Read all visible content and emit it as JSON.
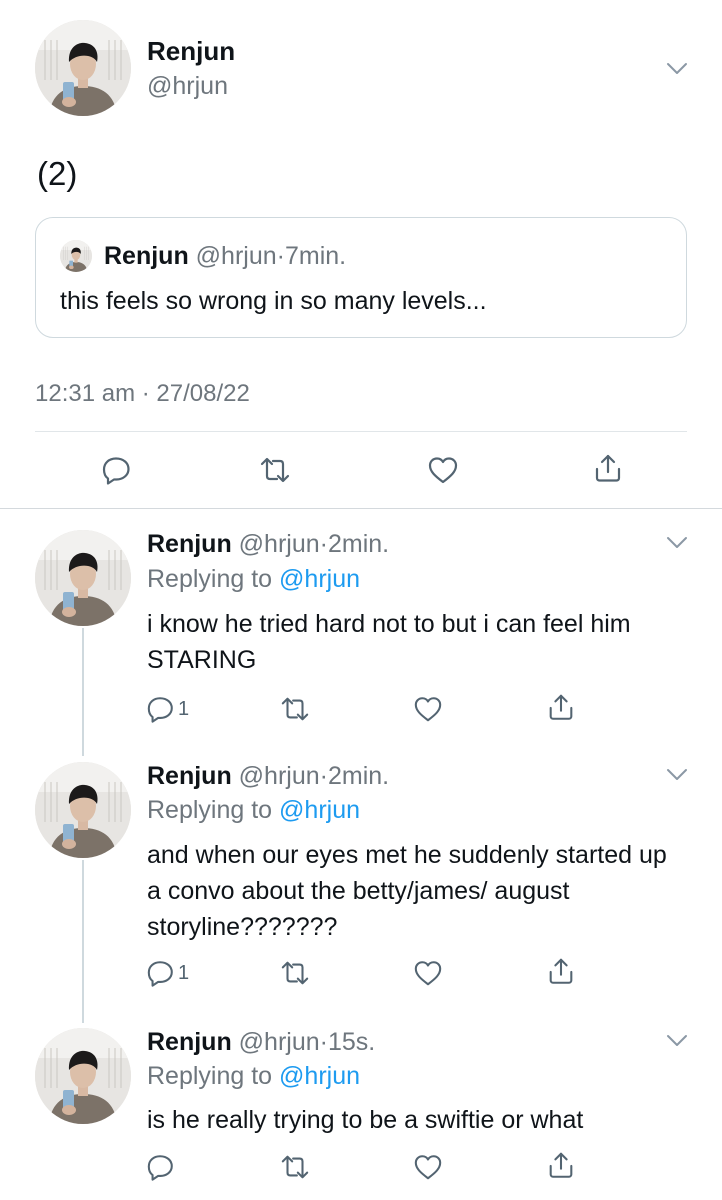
{
  "colors": {
    "text": "#0f1419",
    "secondary": "#6e767d",
    "accent": "#1d9bf0",
    "border": "#cfd9de"
  },
  "main_tweet": {
    "display_name": "Renjun",
    "handle": "@hrjun",
    "text": "(2)",
    "quote": {
      "display_name": "Renjun",
      "handle": "@hrjun",
      "time": "7min.",
      "text": "this feels so wrong in so many levels..."
    },
    "timestamp": "12:31 am · 27/08/22",
    "icons": [
      "reply-icon",
      "retweet-icon",
      "like-icon",
      "share-icon"
    ]
  },
  "replies": [
    {
      "display_name": "Renjun",
      "handle": "@hrjun",
      "time": "2min.",
      "replying_label": "Replying to",
      "replying_to": "@hrjun",
      "text": "i know he tried hard not to but i can feel him STARING",
      "reply_count": "1"
    },
    {
      "display_name": "Renjun",
      "handle": "@hrjun",
      "time": "2min.",
      "replying_label": "Replying to",
      "replying_to": "@hrjun",
      "text": "and when our eyes met he suddenly started up a convo about the betty/james/ august storyline???????",
      "reply_count": "1"
    },
    {
      "display_name": "Renjun",
      "handle": "@hrjun",
      "time": "15s.",
      "replying_label": "Replying to",
      "replying_to": "@hrjun",
      "text": "is he really trying to be a swiftie or what",
      "reply_count": ""
    }
  ]
}
